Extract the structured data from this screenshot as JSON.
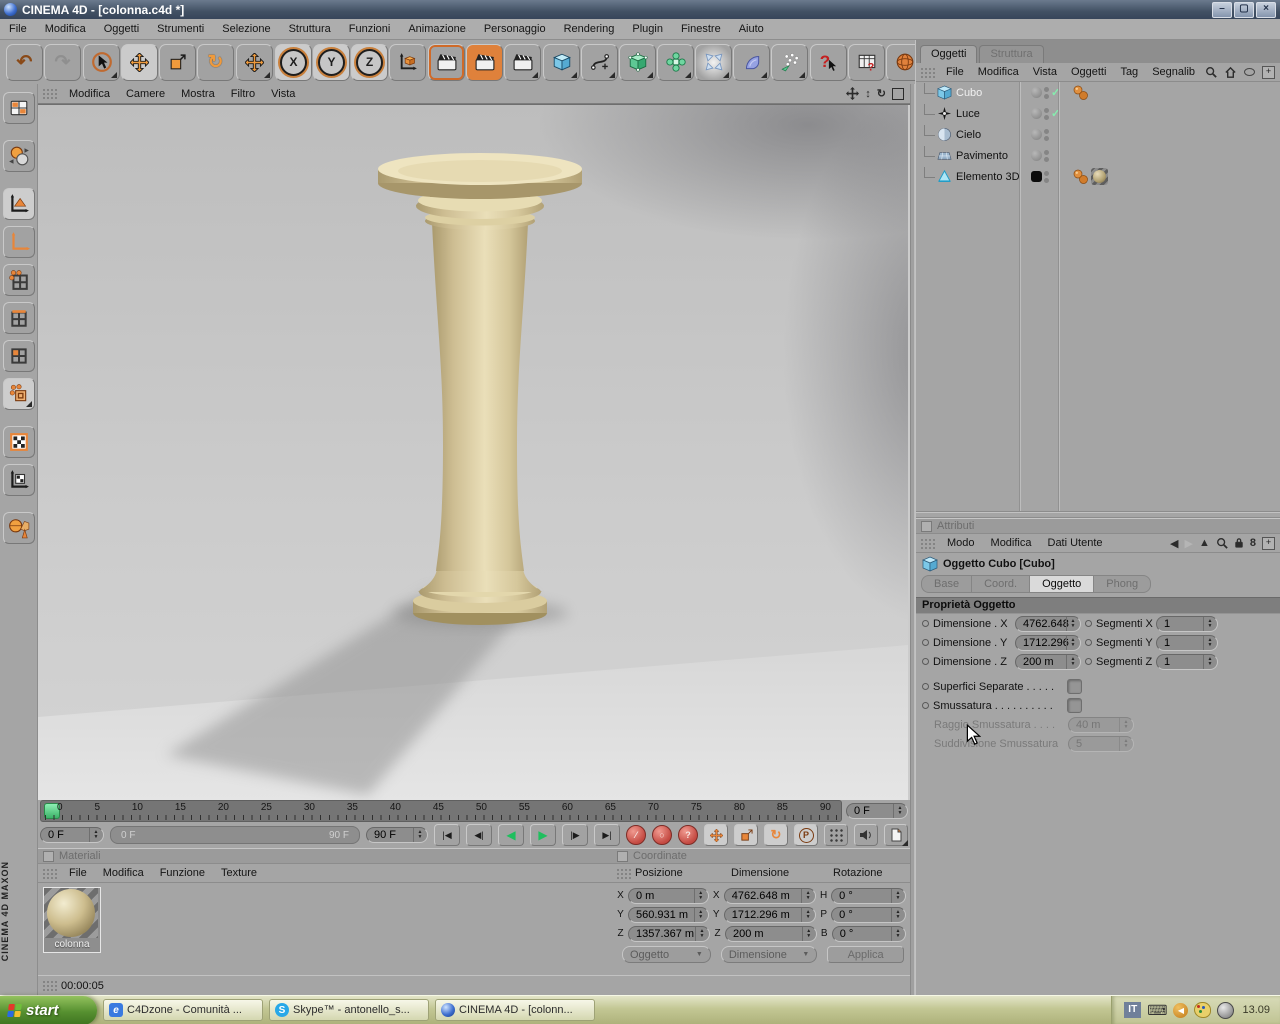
{
  "window": {
    "title": "CINEMA 4D - [colonna.c4d *]"
  },
  "menubar": {
    "items": [
      "File",
      "Modifica",
      "Oggetti",
      "Strumenti",
      "Selezione",
      "Struttura",
      "Funzioni",
      "Animazione",
      "Personaggio",
      "Rendering",
      "Plugin",
      "Finestre",
      "Aiuto"
    ]
  },
  "toolbar": {
    "axis": [
      "X",
      "Y",
      "Z"
    ],
    "help": "?"
  },
  "icons": {
    "undo": "↶",
    "redo": "↷",
    "rotate": "↻",
    "goto_start": "|◀",
    "prev_key": "◀|",
    "play_back": "◀",
    "play": "▶",
    "next_key": "|▶",
    "goto_end": "▶|",
    "rec_key": "⁄",
    "rec_circle": "○",
    "rec_question": "?",
    "p_label": "P",
    "dropdown": "▼",
    "check": "✓",
    "home": "⌂",
    "link": "8",
    "chevron_left": "◀",
    "chevron_right": "▶",
    "chevron_up": "▲",
    "pan": "✢",
    "zoom_updown": "↕",
    "maximize": "▢",
    "minimize": "–",
    "restore": "▢",
    "close": "×",
    "keyboard": "⌨",
    "plus": "+"
  },
  "viewport": {
    "menu": [
      "Modifica",
      "Camere",
      "Mostra",
      "Filtro",
      "Vista"
    ]
  },
  "timeline": {
    "ticks": [
      "0",
      "5",
      "10",
      "15",
      "20",
      "25",
      "30",
      "35",
      "40",
      "45",
      "50",
      "55",
      "60",
      "65",
      "70",
      "75",
      "80",
      "85",
      "90"
    ],
    "frame_field": "0 F",
    "start_field": "0 F",
    "slider_start": "0 F",
    "slider_end": "90 F",
    "end_field": "90 F"
  },
  "materials": {
    "title": "Materiali",
    "menu": [
      "File",
      "Modifica",
      "Funzione",
      "Texture"
    ],
    "items": [
      {
        "name": "colonna"
      }
    ]
  },
  "coordinates": {
    "title": "Coordinate",
    "headers": [
      "Posizione",
      "Dimensione",
      "Rotazione"
    ],
    "rows": [
      {
        "l1": "X",
        "v1": "0 m",
        "l2": "X",
        "v2": "4762.648 m",
        "l3": "H",
        "v3": "0 °"
      },
      {
        "l1": "Y",
        "v1": "560.931 m",
        "l2": "Y",
        "v2": "1712.296 m",
        "l3": "P",
        "v3": "0 °"
      },
      {
        "l1": "Z",
        "v1": "1357.367 m",
        "l2": "Z",
        "v2": "200 m",
        "l3": "B",
        "v3": "0 °"
      }
    ],
    "buttons": {
      "left": "Oggetto",
      "mid": "Dimensione",
      "apply": "Applica"
    }
  },
  "statusbar": {
    "time": "00:00:05"
  },
  "object_manager": {
    "tabs": [
      "Oggetti",
      "Struttura"
    ],
    "menu": [
      "File",
      "Modifica",
      "Vista",
      "Oggetti",
      "Tag",
      "Segnalib"
    ],
    "objects": [
      {
        "name": "Cubo"
      },
      {
        "name": "Luce"
      },
      {
        "name": "Cielo"
      },
      {
        "name": "Pavimento"
      },
      {
        "name": "Elemento 3D"
      }
    ]
  },
  "attributes": {
    "title": "Attributi",
    "menu": [
      "Modo",
      "Modifica",
      "Dati Utente"
    ],
    "object_title": "Oggetto Cubo [Cubo]",
    "tabs": [
      "Base",
      "Coord.",
      "Oggetto",
      "Phong"
    ],
    "section": "Proprietà Oggetto",
    "dims": [
      {
        "label": "Dimensione . X",
        "value": "4762.648",
        "seg": "Segmenti X",
        "segv": "1"
      },
      {
        "label": "Dimensione . Y",
        "value": "1712.296",
        "seg": "Segmenti Y",
        "segv": "1"
      },
      {
        "label": "Dimensione . Z",
        "value": "200 m",
        "seg": "Segmenti Z",
        "segv": "1"
      }
    ],
    "checks": [
      {
        "label": "Superfici Separate . . . . ."
      },
      {
        "label": "Smussatura . . . . . . . . . ."
      }
    ],
    "disabled": [
      {
        "label": "Raggio Smussatura . . . .",
        "value": "40 m"
      },
      {
        "label": "Suddivisione Smussatura",
        "value": "5"
      }
    ]
  },
  "branding": {
    "line1": "MAXON",
    "line2": "CINEMA 4D"
  },
  "taskbar": {
    "start": "start",
    "tasks": [
      {
        "title": "C4Dzone - Comunità ..."
      },
      {
        "title": "Skype™ - antonello_s..."
      },
      {
        "title": "CINEMA 4D - [colonn..."
      }
    ],
    "tray": {
      "lang": "IT",
      "clock": "13.09"
    }
  }
}
